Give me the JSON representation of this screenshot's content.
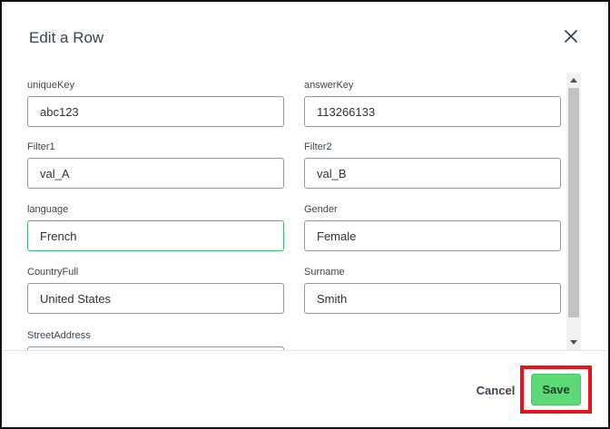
{
  "dialog": {
    "title": "Edit a Row",
    "close_icon": "close-icon"
  },
  "fields": {
    "uniqueKey": {
      "label": "uniqueKey",
      "value": "abc123"
    },
    "answerKey": {
      "label": "answerKey",
      "value": "113266133"
    },
    "filter1": {
      "label": "Filter1",
      "value": "val_A"
    },
    "filter2": {
      "label": "Filter2",
      "value": "val_B"
    },
    "language": {
      "label": "language",
      "value": "French"
    },
    "gender": {
      "label": "Gender",
      "value": "Female"
    },
    "countryFull": {
      "label": "CountryFull",
      "value": "United States"
    },
    "surname": {
      "label": "Surname",
      "value": "Smith"
    },
    "streetAddress": {
      "label": "StreetAddress",
      "value": ""
    }
  },
  "footer": {
    "cancel_label": "Cancel",
    "save_label": "Save"
  },
  "colors": {
    "focus_border": "#3bb873",
    "save_button": "#5ed977",
    "highlight": "#e8141a"
  }
}
